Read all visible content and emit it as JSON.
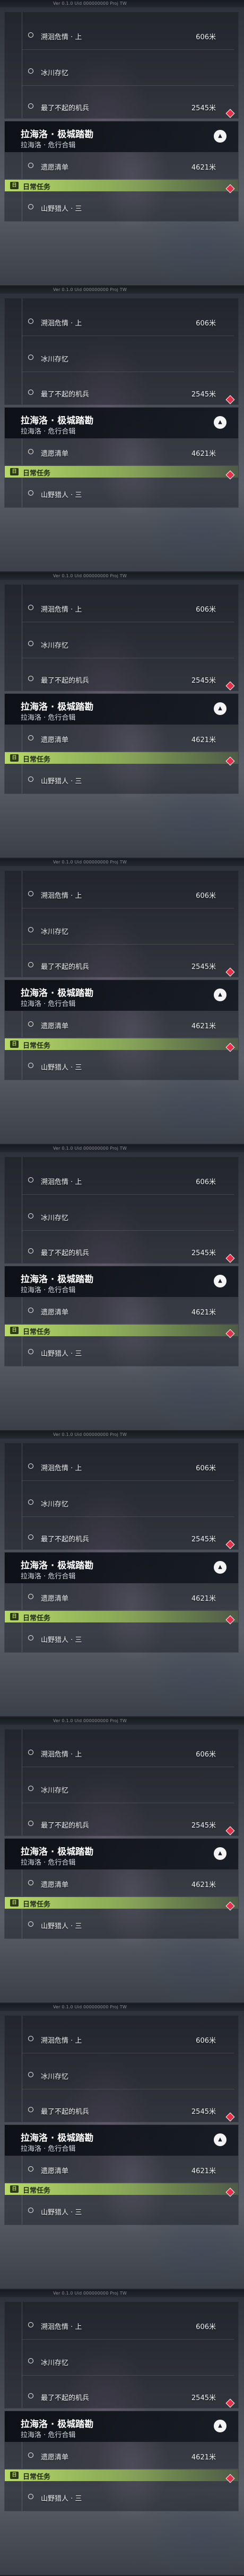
{
  "frames": [
    {
      "topbar_text": "Ver 0.1.0  Uid 000000000  Proj TW",
      "sub_quests": [
        {
          "name": "溯洄危情 · 上",
          "distance": "606米"
        },
        {
          "name": "冰川存忆",
          "distance": ""
        },
        {
          "name": "最了不起的机兵",
          "distance": "2545米"
        }
      ],
      "main_quest": {
        "title": "拉海洛 · 极城踏勘",
        "subtitle": "拉海洛 · 危行合辑",
        "objective": "遗愿清单",
        "objective_distance": "4621米"
      },
      "daily": {
        "label": "日常任务",
        "quest": "山野猎人 · 三"
      }
    },
    {
      "topbar_text": "Ver 0.1.0  Uid 000000000  Proj TW",
      "sub_quests": [
        {
          "name": "溯洄危情 · 上",
          "distance": "606米"
        },
        {
          "name": "冰川存忆",
          "distance": ""
        },
        {
          "name": "最了不起的机兵",
          "distance": "2545米"
        }
      ],
      "main_quest": {
        "title": "拉海洛 · 极城踏勘",
        "subtitle": "拉海洛 · 危行合辑",
        "objective": "遗愿清单",
        "objective_distance": "4621米"
      },
      "daily": {
        "label": "日常任务",
        "quest": "山野猎人 · 三"
      }
    },
    {
      "topbar_text": "Ver 0.1.0  Uid 000000000  Proj TW",
      "sub_quests": [
        {
          "name": "溯洄危情 · 上",
          "distance": "606米"
        },
        {
          "name": "冰川存忆",
          "distance": ""
        },
        {
          "name": "最了不起的机兵",
          "distance": "2545米"
        }
      ],
      "main_quest": {
        "title": "拉海洛 · 极城踏勘",
        "subtitle": "拉海洛 · 危行合辑",
        "objective": "遗愿清单",
        "objective_distance": "4621米"
      },
      "daily": {
        "label": "日常任务",
        "quest": "山野猎人 · 三"
      }
    },
    {
      "topbar_text": "Ver 0.1.0  Uid 000000000  Proj TW",
      "sub_quests": [
        {
          "name": "溯洄危情 · 上",
          "distance": "606米"
        },
        {
          "name": "冰川存忆",
          "distance": ""
        },
        {
          "name": "最了不起的机兵",
          "distance": "2545米"
        }
      ],
      "main_quest": {
        "title": "拉海洛 · 极城踏勘",
        "subtitle": "拉海洛 · 危行合辑",
        "objective": "遗愿清单",
        "objective_distance": "4621米"
      },
      "daily": {
        "label": "日常任务",
        "quest": "山野猎人 · 三"
      }
    },
    {
      "topbar_text": "Ver 0.1.0  Uid 000000000  Proj TW",
      "sub_quests": [
        {
          "name": "溯洄危情 · 上",
          "distance": "606米"
        },
        {
          "name": "冰川存忆",
          "distance": ""
        },
        {
          "name": "最了不起的机兵",
          "distance": "2545米"
        }
      ],
      "main_quest": {
        "title": "拉海洛 · 极城踏勘",
        "subtitle": "拉海洛 · 危行合辑",
        "objective": "遗愿清单",
        "objective_distance": "4621米"
      },
      "daily": {
        "label": "日常任务",
        "quest": "山野猎人 · 三"
      }
    },
    {
      "topbar_text": "Ver 0.1.0  Uid 000000000  Proj TW",
      "sub_quests": [
        {
          "name": "溯洄危情 · 上",
          "distance": "606米"
        },
        {
          "name": "冰川存忆",
          "distance": ""
        },
        {
          "name": "最了不起的机兵",
          "distance": "2545米"
        }
      ],
      "main_quest": {
        "title": "拉海洛 · 极城踏勘",
        "subtitle": "拉海洛 · 危行合辑",
        "objective": "遗愿清单",
        "objective_distance": "4621米"
      },
      "daily": {
        "label": "日常任务",
        "quest": "山野猎人 · 三"
      }
    },
    {
      "topbar_text": "Ver 0.1.0  Uid 000000000  Proj TW",
      "sub_quests": [
        {
          "name": "溯洄危情 · 上",
          "distance": "606米"
        },
        {
          "name": "冰川存忆",
          "distance": ""
        },
        {
          "name": "最了不起的机兵",
          "distance": "2545米"
        }
      ],
      "main_quest": {
        "title": "拉海洛 · 极城踏勘",
        "subtitle": "拉海洛 · 危行合辑",
        "objective": "遗愿清单",
        "objective_distance": "4621米"
      },
      "daily": {
        "label": "日常任务",
        "quest": "山野猎人 · 三"
      }
    },
    {
      "topbar_text": "Ver 0.1.0  Uid 000000000  Proj TW",
      "sub_quests": [
        {
          "name": "溯洄危情 · 上",
          "distance": "606米"
        },
        {
          "name": "冰川存忆",
          "distance": ""
        },
        {
          "name": "最了不起的机兵",
          "distance": "2545米"
        }
      ],
      "main_quest": {
        "title": "拉海洛 · 极城踏勘",
        "subtitle": "拉海洛 · 危行合辑",
        "objective": "遗愿清单",
        "objective_distance": "4621米"
      },
      "daily": {
        "label": "日常任务",
        "quest": "山野猎人 · 三"
      }
    },
    {
      "topbar_text": "Ver 0.1.0  Uid 000000000  Proj TW",
      "sub_quests": [
        {
          "name": "溯洄危情 · 上",
          "distance": "606米"
        },
        {
          "name": "冰川存忆",
          "distance": ""
        },
        {
          "name": "最了不起的机兵",
          "distance": "2545米"
        }
      ],
      "main_quest": {
        "title": "拉海洛 · 极城踏勘",
        "subtitle": "拉海洛 · 危行合辑",
        "objective": "遗愿清单",
        "objective_distance": "4621米"
      },
      "daily": {
        "label": "日常任务",
        "quest": "山野猎人 · 三"
      }
    }
  ],
  "icons": {
    "collapse": "chevron-up-icon",
    "quest_marker": "circle-icon",
    "daily": "daily-task-icon",
    "tracker": "diamond-marker-icon"
  },
  "colors": {
    "daily_accent": "#b7d86a",
    "tracker_marker": "#e1304a"
  }
}
